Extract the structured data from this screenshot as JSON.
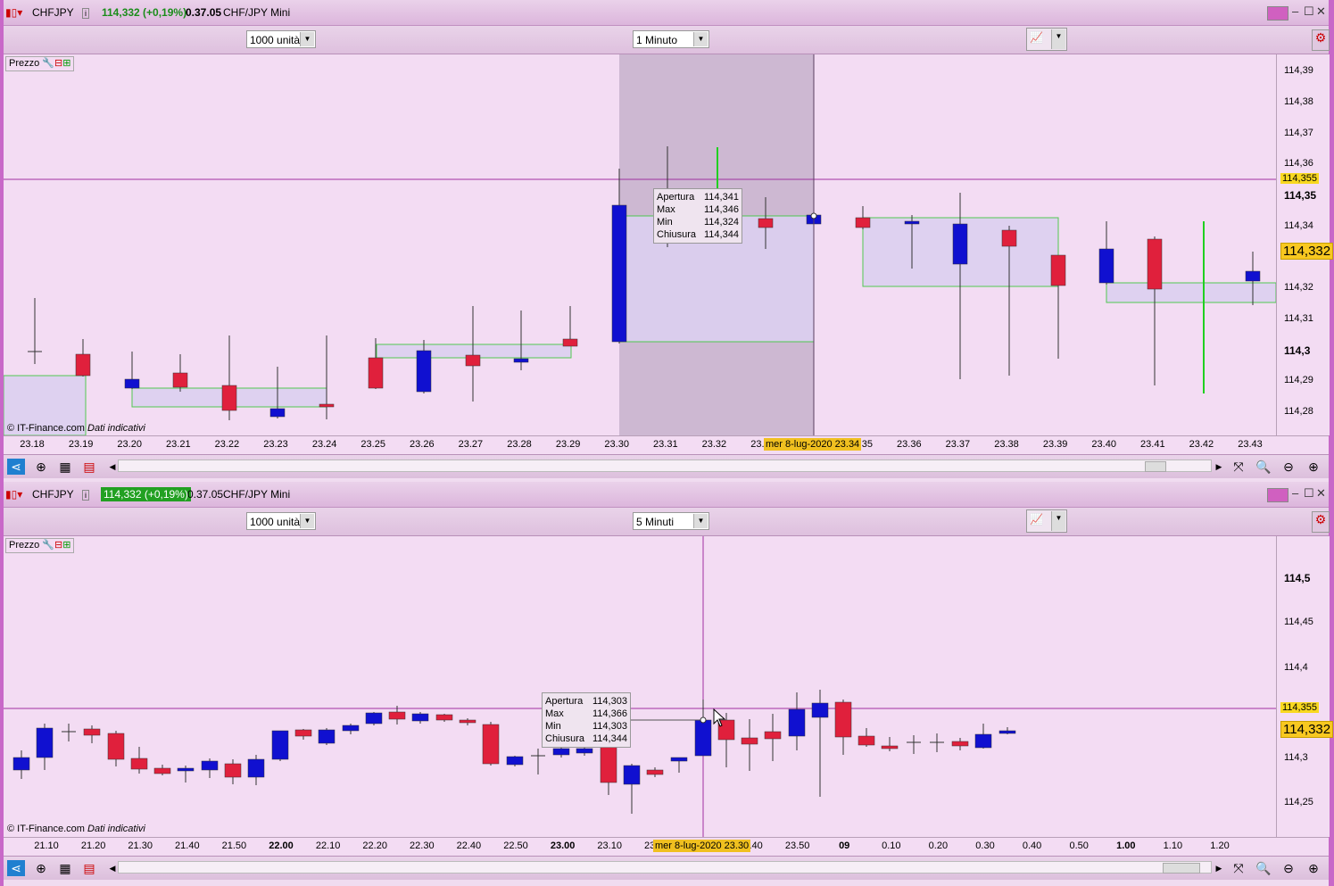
{
  "panels": [
    {
      "symbol": "CHFJPY",
      "price": "114,332 (+0,19%)",
      "price_highlight": false,
      "time": "0.37.05",
      "instrument": "CHF/JPY Mini",
      "units": "1000 unità",
      "interval": "1 Minuto",
      "prezzo": "Prezzo",
      "copyright": "© IT-Finance.com",
      "disclaimer": "Dati indicativi",
      "x_ticks": [
        "23.18",
        "23.19",
        "23.20",
        "23.21",
        "23.22",
        "23.23",
        "23.24",
        "23.25",
        "23.26",
        "23.27",
        "23.28",
        "23.29",
        "23.30",
        "23.31",
        "23.32",
        "23.33",
        "23.34",
        "23.35",
        "23.36",
        "23.37",
        "23.38",
        "23.39",
        "23.40",
        "23.41",
        "23.42",
        "23.43"
      ],
      "x_cursor": "mer 8-lug-2020 23.34",
      "y_ticks": [
        "114,39",
        "114,38",
        "114,37",
        "114,36",
        "114,35",
        "114,34",
        "114,32",
        "114,31",
        "114,3",
        "114,29",
        "114,28"
      ],
      "y_marker_line": "114,355",
      "y_marker_current": "114,332",
      "tooltip": {
        "labels": [
          "Apertura",
          "Max",
          "Min",
          "Chiusura"
        ],
        "values": [
          "114,341",
          "114,346",
          "114,324",
          "114,344"
        ]
      }
    },
    {
      "symbol": "CHFJPY",
      "price": "114,332 (+0,19%)",
      "price_highlight": true,
      "time": "0.37.05",
      "instrument": "CHF/JPY Mini",
      "units": "1000 unità",
      "interval": "5 Minuti",
      "prezzo": "Prezzo",
      "copyright": "© IT-Finance.com",
      "disclaimer": "Dati indicativi",
      "x_ticks": [
        "21.10",
        "21.20",
        "21.30",
        "21.40",
        "21.50",
        "22.00",
        "22.10",
        "22.20",
        "22.30",
        "22.40",
        "22.50",
        "23.00",
        "23.10",
        "23.20",
        "23.30",
        "23.40",
        "23.50",
        "09",
        "0.10",
        "0.20",
        "0.30",
        "0.40",
        "0.50",
        "1.00",
        "1.10",
        "1.20"
      ],
      "x_cursor": "mer 8-lug-2020 23.30",
      "y_ticks": [
        "114,5",
        "114,45",
        "114,4",
        "114,3",
        "114,25"
      ],
      "y_marker_line": "114,355",
      "y_marker_current": "114,332",
      "tooltip": {
        "labels": [
          "Apertura",
          "Max",
          "Min",
          "Chiusura"
        ],
        "values": [
          "114,303",
          "114,366",
          "114,303",
          "114,344"
        ]
      }
    }
  ],
  "colors": {
    "bull": "#1010d0",
    "bear": "#e0203c",
    "doji_green": "#20d020",
    "box": "#40c840"
  }
}
